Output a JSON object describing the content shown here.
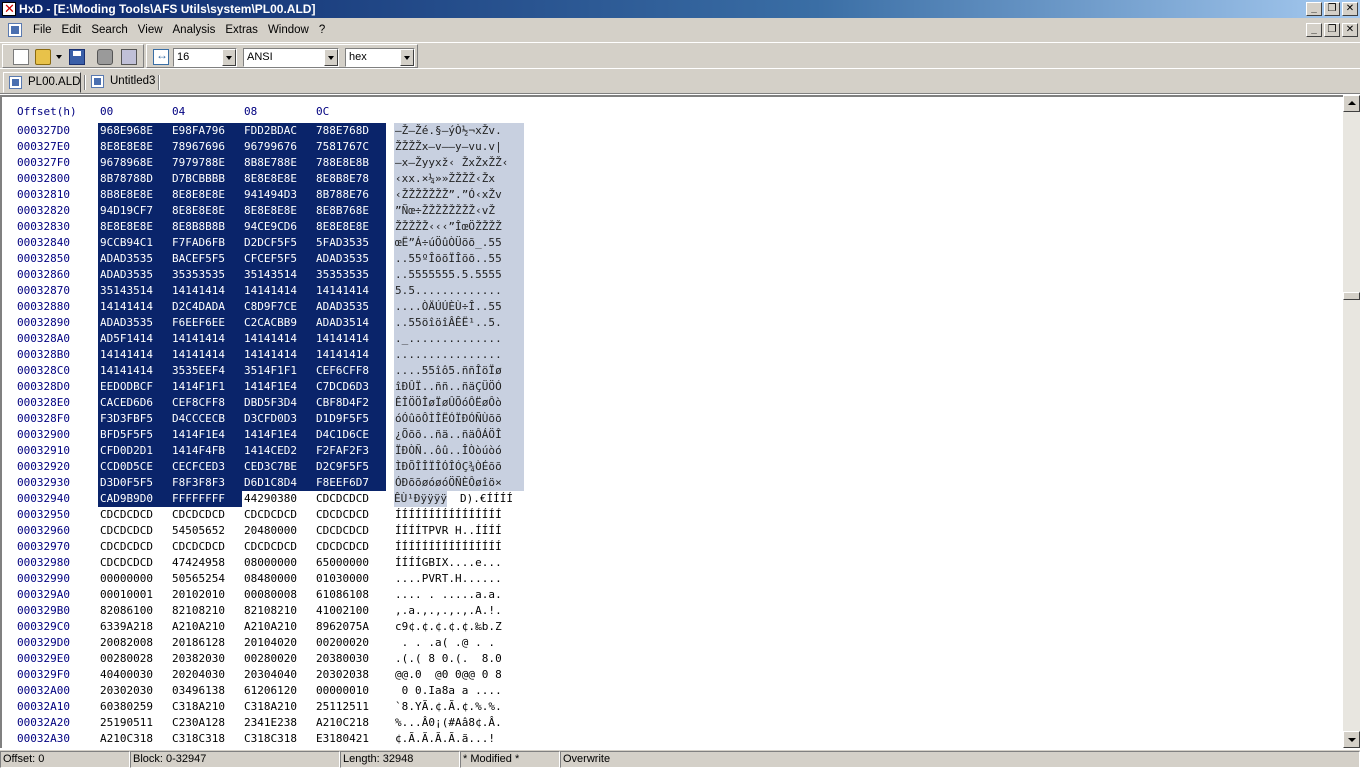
{
  "window": {
    "title": "HxD - [E:\\Moding Tools\\AFS Utils\\system\\PL00.ALD]",
    "min": "_",
    "restore": "❐",
    "close": "✕"
  },
  "menu": [
    "File",
    "Edit",
    "Search",
    "View",
    "Analysis",
    "Extras",
    "Window",
    "?"
  ],
  "toolbar": {
    "bytes_per_row": "16",
    "charset": "ANSI",
    "offset_base": "hex"
  },
  "tabs": [
    "PL00.ALD",
    "Untitled3"
  ],
  "editor": {
    "offset_header": "Offset(h)",
    "column_headers": [
      "00",
      "04",
      "08",
      "0C"
    ],
    "rows": [
      {
        "o": "000327D0",
        "h": [
          "968E968E",
          "E98FA796",
          "FDD2BDAC",
          "788E768D"
        ],
        "a": "–Ž–Žé.§–ýÒ½¬xŽv."
      },
      {
        "o": "000327E0",
        "h": [
          "8E8E8E8E",
          "78967696",
          "96799676",
          "7581767C"
        ],
        "a": "ŽŽŽŽx–v––y–vu.v|"
      },
      {
        "o": "000327F0",
        "h": [
          "9678968E",
          "7979788E",
          "8B8E788E",
          "788E8E8B"
        ],
        "a": "–x–Žyyxž‹ ŽxŽxŽŽ‹"
      },
      {
        "o": "00032800",
        "h": [
          "8B78788D",
          "D7BCBBBB",
          "8E8E8E8E",
          "8E8B8E78"
        ],
        "a": "‹xx.×¼»»ŽŽŽŽ‹Žx"
      },
      {
        "o": "00032810",
        "h": [
          "8B8E8E8E",
          "8E8E8E8E",
          "941494D3",
          "8B788E76"
        ],
        "a": "‹ŽŽŽŽŽŽŽ”.”Ó‹xŽv"
      },
      {
        "o": "00032820",
        "h": [
          "94D19CF7",
          "8E8E8E8E",
          "8E8E8E8E",
          "8E8B768E"
        ],
        "a": "”Ñœ÷ŽŽŽŽŽŽŽŽ‹vŽ"
      },
      {
        "o": "00032830",
        "h": [
          "8E8E8E8E",
          "8E8B8B8B",
          "94CE9CD6",
          "8E8E8E8E"
        ],
        "a": "ŽŽŽŽŽ‹‹‹”ÎœÖŽŽŽŽ"
      },
      {
        "o": "00032840",
        "h": [
          "9CCB94C1",
          "F7FAD6FB",
          "D2DCF5F5",
          "5FAD3535"
        ],
        "a": "œË”Á÷úÖûÒÜõõ_.55"
      },
      {
        "o": "00032850",
        "h": [
          "ADAD3535",
          "BACEF5F5",
          "CFCEF5F5",
          "ADAD3535"
        ],
        "a": "..55ºÎõõÏÎõõ..55"
      },
      {
        "o": "00032860",
        "h": [
          "ADAD3535",
          "35353535",
          "35143514",
          "35353535"
        ],
        "a": "..5555555.5.5555"
      },
      {
        "o": "00032870",
        "h": [
          "35143514",
          "14141414",
          "14141414",
          "14141414"
        ],
        "a": "5.5............."
      },
      {
        "o": "00032880",
        "h": [
          "14141414",
          "D2C4DADA",
          "C8D9F7CE",
          "ADAD3535"
        ],
        "a": "....ÒÄÚÚÈÙ÷Î..55"
      },
      {
        "o": "00032890",
        "h": [
          "ADAD3535",
          "F6EEF6EE",
          "C2CACBB9",
          "ADAD3514"
        ],
        "a": "..55öîöîÂÊË¹..5."
      },
      {
        "o": "000328A0",
        "h": [
          "AD5F1414",
          "14141414",
          "14141414",
          "14141414"
        ],
        "a": "._.............."
      },
      {
        "o": "000328B0",
        "h": [
          "14141414",
          "14141414",
          "14141414",
          "14141414"
        ],
        "a": "................"
      },
      {
        "o": "000328C0",
        "h": [
          "14141414",
          "3535EEF4",
          "3514F1F1",
          "CEF6CFF8"
        ],
        "a": "....55îô5.ññÎöÏø"
      },
      {
        "o": "000328D0",
        "h": [
          "EEDODBCF",
          "1414F1F1",
          "1414F1E4",
          "C7DCD6D3"
        ],
        "a": "îÐÛÏ..ññ..ñäÇÜÖÓ"
      },
      {
        "o": "000328E0",
        "h": [
          "CACED6D6",
          "CEF8CFF8",
          "DBD5F3D4",
          "CBF8D4F2"
        ],
        "a": "ÊÎÖÖÎøÏøÛÕóÔËøÔò"
      },
      {
        "o": "000328F0",
        "h": [
          "F3D3FBF5",
          "D4CCCECB",
          "D3CFD0D3",
          "D1D9F5F5"
        ],
        "a": "óÓûõÔÌÎËÓÏÐÓÑÙõõ"
      },
      {
        "o": "00032900",
        "h": [
          "BFD5F5F5",
          "1414F1E4",
          "1414F1E4",
          "D4C1D6CE"
        ],
        "a": "¿Õõõ..ñä..ñäÔÁÖÎ"
      },
      {
        "o": "00032910",
        "h": [
          "CFD0D2D1",
          "1414F4FB",
          "1414CED2",
          "F2FAF2F3"
        ],
        "a": "ÏÐÒÑ..ôû..ÎÒòúòó"
      },
      {
        "o": "00032920",
        "h": [
          "CCD0D5CE",
          "CECFCED3",
          "CED3C7BE",
          "D2C9F5F5"
        ],
        "a": "ÌÐÕÎÎÏÎÓÎÓÇ¾ÒÉõõ"
      },
      {
        "o": "00032930",
        "h": [
          "D3D0F5F5",
          "F8F3F8F3",
          "D6D1C8D4",
          "F8EEF6D7"
        ],
        "a": "ÓÐõõøóøóÖÑÈÔøîö×"
      },
      {
        "o": "00032940",
        "h": [
          "CAD9B9D0",
          "FFFFFFFF",
          "44290380",
          "CDCDCDCD"
        ],
        "a": "ÊÙ¹Ðÿÿÿÿ",
        "a2": "D).€ÍÍÍÍ"
      },
      {
        "o": "00032950",
        "h": [
          "CDCDCDCD",
          "CDCDCDCD",
          "CDCDCDCD",
          "CDCDCDCD"
        ],
        "a": "ÍÍÍÍÍÍÍÍÍÍÍÍÍÍÍÍ"
      },
      {
        "o": "00032960",
        "h": [
          "CDCDCDCD",
          "54505652",
          "20480000",
          "CDCDCDCD"
        ],
        "a": "ÍÍÍÍTPVR H..ÍÍÍÍ"
      },
      {
        "o": "00032970",
        "h": [
          "CDCDCDCD",
          "CDCDCDCD",
          "CDCDCDCD",
          "CDCDCDCD"
        ],
        "a": "ÍÍÍÍÍÍÍÍÍÍÍÍÍÍÍÍ"
      },
      {
        "o": "00032980",
        "h": [
          "CDCDCDCD",
          "47424958",
          "08000000",
          "65000000"
        ],
        "a": "ÍÍÍÍGBIX....e..."
      },
      {
        "o": "00032990",
        "h": [
          "00000000",
          "50565254",
          "08480000",
          "01030000"
        ],
        "a": "....PVRT.H......"
      },
      {
        "o": "000329A0",
        "h": [
          "00010001",
          "20102010",
          "00080008",
          "61086108"
        ],
        "a": ".... . .....a.a."
      },
      {
        "o": "000329B0",
        "h": [
          "82086100",
          "82108210",
          "82108210",
          "41002100"
        ],
        "a": ",.a.,.,.,.,.A.!."
      },
      {
        "o": "000329C0",
        "h": [
          "6339A218",
          "A210A210",
          "A210A210",
          "8962075A"
        ],
        "a": "c9¢.¢.¢.¢.¢.‰b.Z"
      },
      {
        "o": "000329D0",
        "h": [
          "20082008",
          "20186128",
          "20104020",
          "00200020"
        ],
        "a": " . . .a( .@ . . "
      },
      {
        "o": "000329E0",
        "h": [
          "00280028",
          "20382030",
          "00280020",
          "20380030"
        ],
        "a": ".(.( 8 0.(.  8.0"
      },
      {
        "o": "000329F0",
        "h": [
          "40400030",
          "20204030",
          "20304040",
          "20302038"
        ],
        "a": "@@.0  @0 0@@ 0 8"
      },
      {
        "o": "00032A00",
        "h": [
          "20302030",
          "03496138",
          "61206120",
          "00000010"
        ],
        "a": " 0 0.Ia8a a ...."
      },
      {
        "o": "00032A10",
        "h": [
          "60380259",
          "C318A210",
          "C318A210",
          "25112511"
        ],
        "a": "`8.YÃ.¢.Ã.¢.%.%."
      },
      {
        "o": "00032A20",
        "h": [
          "25190511",
          "C230A128",
          "2341E238",
          "A210C218"
        ],
        "a": "%...Â0¡(#Aâ8¢.Â."
      },
      {
        "o": "00032A30",
        "h": [
          "A210C318",
          "C318C318",
          "C318C318",
          "E3180421"
        ],
        "a": "¢.Ã.Ã.Ã.Ã.ã...!"
      }
    ]
  },
  "status": {
    "offset": "Offset: 0",
    "block": "Block: 0-32947",
    "length": "Length: 32948",
    "modified": "* Modified *",
    "mode": "Overwrite"
  }
}
